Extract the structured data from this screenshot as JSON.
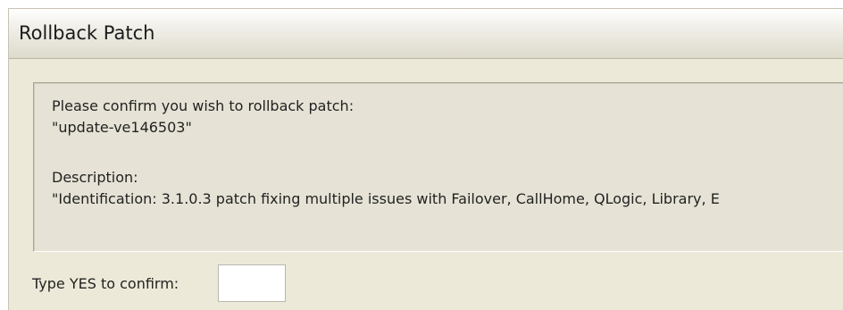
{
  "dialog": {
    "title": "Rollback Patch",
    "message": {
      "confirm_prompt": "Please confirm you wish to rollback patch:",
      "patch_name": "\"update-ve146503\"",
      "description_label": "Description:",
      "description_text": "\"Identification: 3.1.0.3 patch fixing multiple issues with Failover, CallHome, QLogic, Library, E"
    },
    "confirm": {
      "label": "Type YES to confirm:",
      "value": "",
      "placeholder": ""
    }
  }
}
